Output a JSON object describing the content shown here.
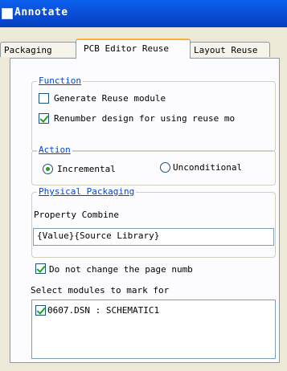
{
  "window": {
    "title": "Annotate"
  },
  "tabs": [
    {
      "label": "Packaging"
    },
    {
      "label": "PCB Editor Reuse"
    },
    {
      "label": "Layout Reuse"
    }
  ],
  "function_group": {
    "legend": "Function",
    "generate_reuse_module": {
      "label": "Generate Reuse module",
      "checked": false
    },
    "renumber_design": {
      "label": "Renumber design for using reuse mo",
      "checked": true
    }
  },
  "action_group": {
    "legend": "Action",
    "incremental": {
      "label": "Incremental",
      "selected": true
    },
    "unconditional": {
      "label": "Unconditional",
      "selected": false
    }
  },
  "physical_packaging": {
    "legend": "Physical Packaging",
    "property_combine_label": "Property Combine",
    "property_combine_value": "{Value}{Source Library}"
  },
  "do_not_change": {
    "label": "Do not change the page numb",
    "checked": true
  },
  "select_modules": {
    "label": "Select modules to mark for",
    "items": [
      {
        "label": "0607.DSN : SCHEMATIC1",
        "checked": true
      }
    ]
  }
}
